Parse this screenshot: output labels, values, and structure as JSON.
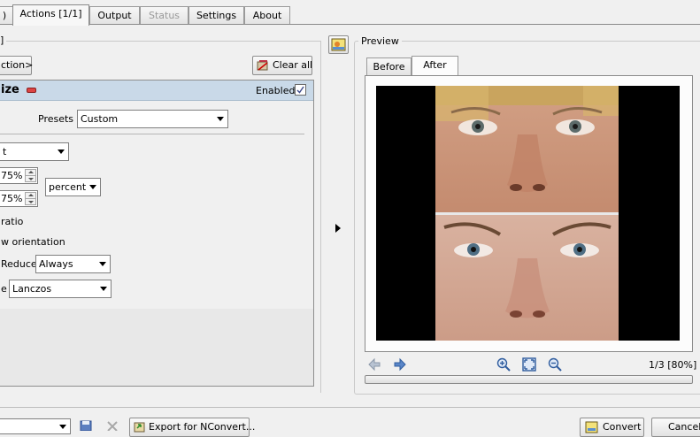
{
  "tabs": [
    {
      "label": ")",
      "state": "normal"
    },
    {
      "label": "Actions [1/1]",
      "state": "active"
    },
    {
      "label": "Output",
      "state": "normal"
    },
    {
      "label": "Status",
      "state": "disabled"
    },
    {
      "label": "Settings",
      "state": "normal"
    },
    {
      "label": "About",
      "state": "normal"
    }
  ],
  "actions": {
    "group_title": "]",
    "add_action_label": "ction>",
    "clear_all_label": "Clear all",
    "action_title": "ize",
    "enabled_label": "Enabled",
    "enabled_checked": true,
    "presets_label": "Presets",
    "presets_value": "Custom",
    "mode_value": "t",
    "width_value": "75%",
    "height_value": "75%",
    "unit_value": "percent",
    "ratio_label": "ratio",
    "orientation_label": "w orientation",
    "reduce_label": "Reduce",
    "reduce_value": "Always",
    "resample_label": "e",
    "resample_value": "Lanczos"
  },
  "preview": {
    "title": "Preview",
    "tabs": [
      "Before",
      "After"
    ],
    "active_tab": "After",
    "page_info": "1/3 [80%]",
    "progress": 0
  },
  "bottom": {
    "export_label": "Export for NConvert...",
    "convert_label": "Convert",
    "cancel_label": "Cancel"
  },
  "colors": {
    "header_blue": "#c9d9e8",
    "skin": "#c99a7e"
  }
}
